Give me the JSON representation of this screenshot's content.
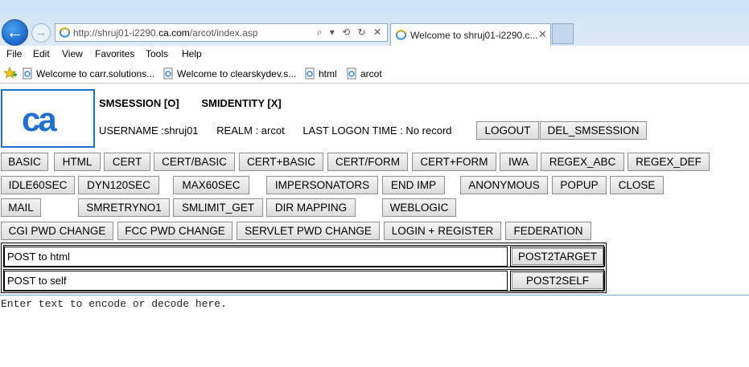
{
  "browser": {
    "address": {
      "prefix": "http://shruj01-i2290.",
      "domain": "ca.com",
      "path": "/arcot/index.asp",
      "tools": "⌕ ▾ ⟲ ↻ ✕"
    },
    "tab_title": "Welcome to shruj01-i2290.c...",
    "tab_close": "✕",
    "menu": [
      "File",
      "Edit",
      "View",
      "Favorites",
      "Tools",
      "Help"
    ],
    "favorites": [
      "Welcome to carr.solutions...",
      "Welcome to clearskydev.s...",
      "html",
      "arcot"
    ]
  },
  "header": {
    "logo_text": "ca",
    "smsession": "SMSESSION [O]",
    "smidentity": "SMIDENTITY [X]",
    "username": "USERNAME :shruj01",
    "realm": "REALM : arcot",
    "last_logon": "LAST LOGON TIME : No record",
    "logout": "LOGOUT",
    "del_smsession": "DEL_SMSESSION"
  },
  "buttons": {
    "row1": [
      "BASIC",
      "HTML",
      "CERT",
      "CERT/BASIC",
      "CERT+BASIC",
      "CERT/FORM",
      "CERT+FORM",
      "IWA",
      "REGEX_ABC",
      "REGEX_DEF"
    ],
    "row2": [
      "IDLE60SEC",
      "DYN120SEC",
      "MAX60SEC",
      "IMPERSONATORS",
      "END IMP",
      "ANONYMOUS",
      "POPUP",
      "CLOSE"
    ],
    "row3": [
      "MAIL",
      "SMRETRYNO1",
      "SMLIMIT_GET",
      "DIR MAPPING",
      "WEBLOGIC"
    ],
    "row4": [
      "CGI PWD CHANGE",
      "FCC PWD CHANGE",
      "SERVLET PWD CHANGE",
      "LOGIN + REGISTER",
      "FEDERATION"
    ]
  },
  "post_forms": {
    "html_value": "POST to html",
    "html_button": "POST2TARGET",
    "self_value": "POST to self",
    "self_button": "POST2SELF"
  },
  "encode_placeholder": "Enter text to encode or decode here.",
  "colors": {
    "accent": "#1e6fd0",
    "logo_blue": "#1e6fd0",
    "chrome": "#cfe3f5"
  }
}
